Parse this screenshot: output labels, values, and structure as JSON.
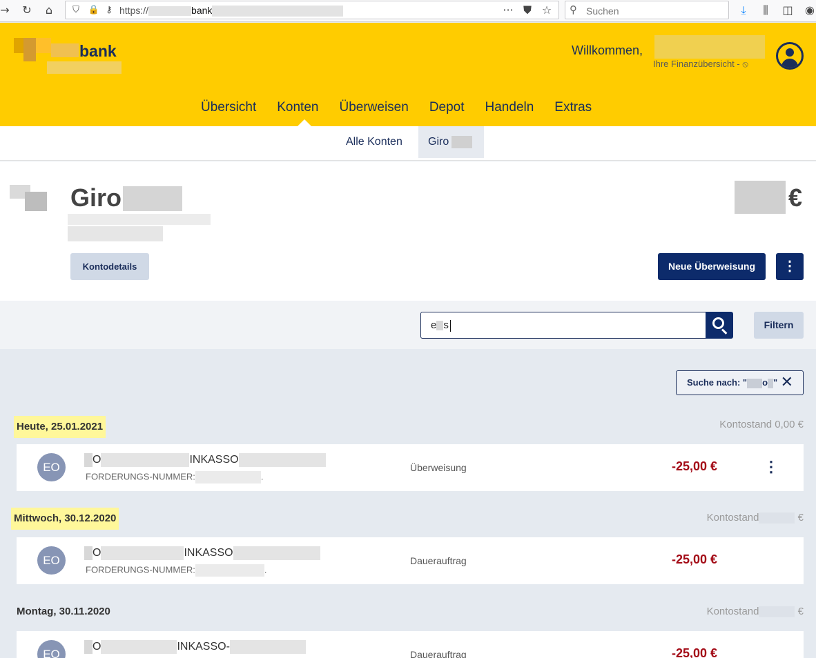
{
  "browser": {
    "url_prefix": "https://",
    "url_domain": "bank",
    "search_placeholder": "Suchen"
  },
  "header": {
    "logo_text": "bank",
    "welcome": "Willkommen,",
    "overview_link": "Ihre Finanzübersicht -",
    "nav": [
      "Übersicht",
      "Konten",
      "Überweisen",
      "Depot",
      "Handeln",
      "Extras"
    ],
    "active_nav": "Konten"
  },
  "subnav": {
    "all": "Alle Konten",
    "giro": "Giro"
  },
  "account": {
    "title": "Giro",
    "currency": "€",
    "details_button": "Kontodetails",
    "new_transfer_button": "Neue Überweisung",
    "more_icon": "⋮"
  },
  "search": {
    "value_prefix": "e",
    "value_suffix": "s",
    "filter_button": "Filtern",
    "chip_prefix": "Suche nach: \"",
    "chip_mid": "o",
    "chip_suffix": "\"",
    "chip_close": "✕"
  },
  "groups": [
    {
      "date": "Heute, 25.01.2021",
      "highlight": true,
      "balance": "Kontostand 0,00 €",
      "tx": {
        "initials": "EO",
        "name_a": "O",
        "name_b": "INKASSO",
        "ref": "FORDERUNGS-NUMMER:",
        "ref_end": ".",
        "type": "Überweisung",
        "amount": "-25,00 €",
        "menu": "⋮"
      }
    },
    {
      "date": "Mittwoch, 30.12.2020",
      "highlight": true,
      "balance_label": "Kontostand",
      "balance_euro": "€",
      "tx": {
        "initials": "EO",
        "name_a": "O",
        "name_b": "INKASSO",
        "ref": "FORDERUNGS-NUMMER:",
        "ref_end": ".",
        "type": "Dauerauftrag",
        "amount": "-25,00 €"
      }
    },
    {
      "date": "Montag, 30.11.2020",
      "highlight": false,
      "balance_label": "Kontostand",
      "balance_euro": "€",
      "tx": {
        "initials": "EO",
        "name_a": "O",
        "name_b": "INKASSO-",
        "type": "Dauerauftrag",
        "amount": "-25,00 €"
      }
    }
  ]
}
